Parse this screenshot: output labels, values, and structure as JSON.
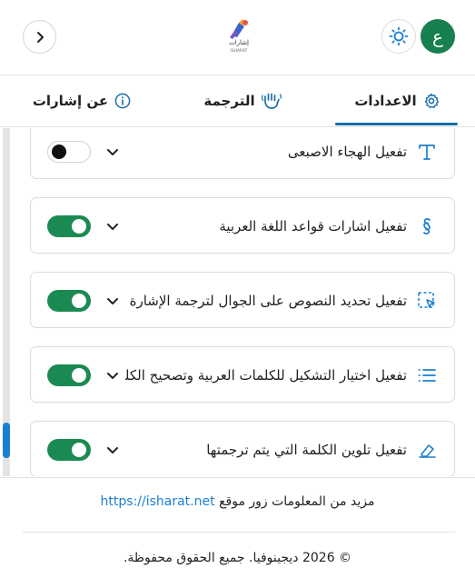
{
  "header": {
    "avatar_letter": "ع",
    "logo_text": "إشارات",
    "logo_subtext": "ISHARAT",
    "icons": {
      "theme": "sun-icon",
      "collapse": "chevron-right-icon"
    }
  },
  "tabs": [
    {
      "label": "الاعدادات",
      "icon": "gear-icon",
      "active": true
    },
    {
      "label": "الترجمة",
      "icon": "hand-icon",
      "active": false
    },
    {
      "label": "عن إشارات",
      "icon": "info-icon",
      "active": false
    }
  ],
  "settings": [
    {
      "label": "تفعيل الهجاء الاصبعى",
      "icon": "text-t-icon",
      "enabled": false
    },
    {
      "label": "تفعيل اشارات قواعد اللغة العربية",
      "icon": "section-icon",
      "enabled": true
    },
    {
      "label": "تفعيل تحديد النصوص على الجوال لترجمة الإشارة",
      "icon": "select-cursor-icon",
      "enabled": true
    },
    {
      "label": "تفعيل اختيار التشكيل للكلمات العربية وتصحيح الكلمات",
      "icon": "list-icon",
      "enabled": true
    },
    {
      "label": "تفعيل تلوين الكلمة التي يتم ترجمتها",
      "icon": "highlighter-icon",
      "enabled": true
    }
  ],
  "footer": {
    "more_info_prefix": "مزيد من المعلومات زور موقع",
    "link_text": "https://isharat.net",
    "copyright": "© 2026 ديجينوفيا. جميع الحقوق محفوظة."
  },
  "colors": {
    "accent": "#1a6ea8",
    "toggle_on": "#1b8a52",
    "avatar": "#18804f",
    "link": "#1a7fd1"
  }
}
